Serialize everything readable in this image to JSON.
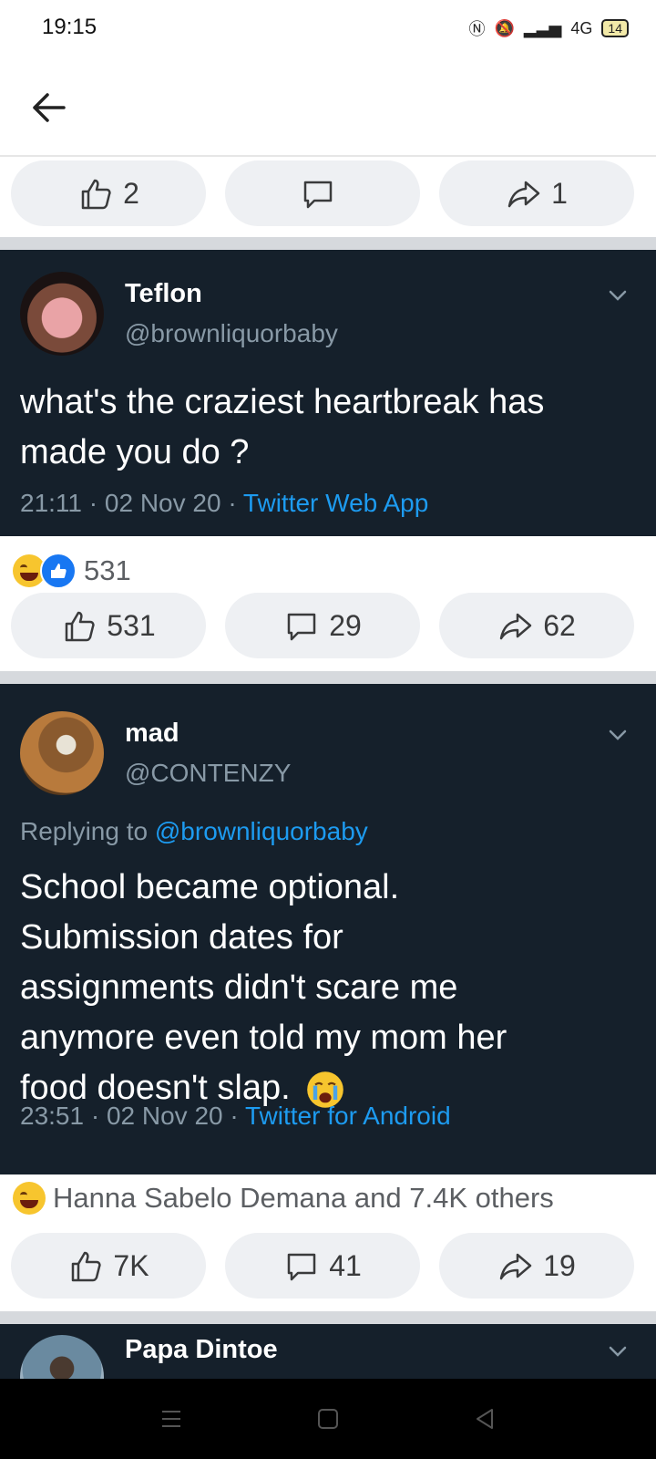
{
  "status_bar": {
    "time": "19:15",
    "network": "4G",
    "battery": "14"
  },
  "top_action_bar": {
    "likes": "2",
    "comments": "",
    "shares": "1"
  },
  "tweets": [
    {
      "name": "Teflon",
      "handle": "@brownliquorbaby",
      "text_line1": "what's the craziest heartbreak has",
      "text_line2": "made you do ?",
      "time": "21:11",
      "date": "02 Nov 20",
      "source": "Twitter Web App"
    },
    {
      "name": "mad",
      "handle": "@CONTENZY",
      "replying_label": "Replying to",
      "replying_to": "@brownliquorbaby",
      "text_line1": "School became optional.",
      "text_line2": "Submission dates for",
      "text_line3": "assignments didn't scare me",
      "text_line4": "anymore even told my mom her",
      "text_line5": "food doesn't slap.",
      "time": "23:51",
      "date": "02 Nov 20",
      "source": "Twitter for Android"
    },
    {
      "name": "Papa Dintoe"
    }
  ],
  "post1_reactions": {
    "count": "531"
  },
  "post1_actions": {
    "likes": "531",
    "comments": "29",
    "shares": "62"
  },
  "post2_reactions": {
    "text": "Hanna Sabelo Demana and 7.4K others"
  },
  "post2_actions": {
    "likes": "7K",
    "comments": "41",
    "shares": "19"
  },
  "colors": {
    "card_bg": "#15202b",
    "link_blue": "#1d9bf0",
    "muted_text": "#8899a6",
    "pill_bg": "#eef0f3"
  },
  "icons": [
    "back-arrow-icon",
    "thumbs-up-icon",
    "comment-icon",
    "share-icon",
    "chevron-down-icon",
    "haha-emoji-icon",
    "like-reaction-icon",
    "crying-emoji-icon"
  ]
}
